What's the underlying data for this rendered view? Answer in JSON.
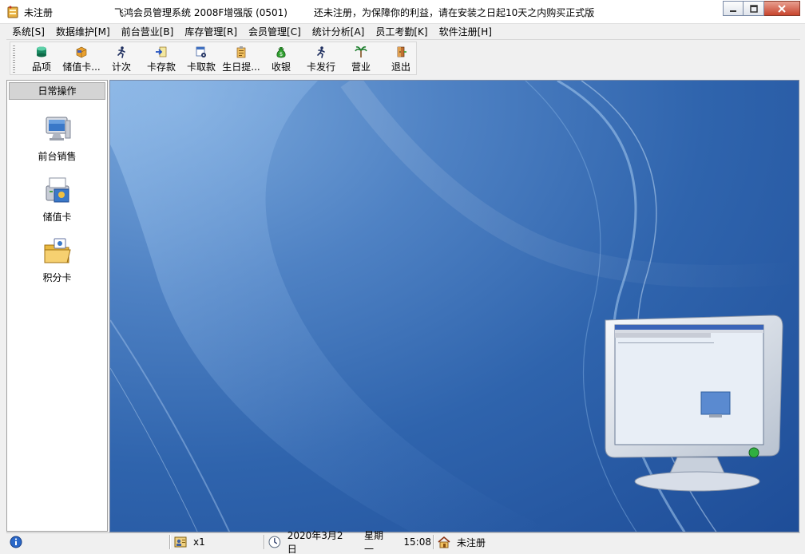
{
  "window": {
    "title_left": "未注册",
    "title_main": "飞鸿会员管理系统  2008F增强版 (0501)",
    "title_notice": "还未注册，为保障你的利益，请在安装之日起10天之内购买正式版"
  },
  "menu": [
    "系统[S]",
    "数据维护[M]",
    "前台营业[B]",
    "库存管理[R]",
    "会员管理[C]",
    "统计分析[A]",
    "员工考勤[K]",
    "软件注册[H]"
  ],
  "toolbar": [
    {
      "label": "品项",
      "icon": "database-icon"
    },
    {
      "label": "储值卡...",
      "icon": "card-box-icon"
    },
    {
      "label": "计次",
      "icon": "runner-icon"
    },
    {
      "label": "卡存款",
      "icon": "deposit-arrow-icon"
    },
    {
      "label": "卡取款",
      "icon": "withdraw-doc-icon"
    },
    {
      "label": "生日提...",
      "icon": "birthday-clipboard-icon"
    },
    {
      "label": "收银",
      "icon": "money-bag-icon"
    },
    {
      "label": "卡发行",
      "icon": "runner-icon"
    },
    {
      "label": "营业",
      "icon": "palm-tree-icon"
    },
    {
      "label": "退出",
      "icon": "exit-door-icon"
    }
  ],
  "sidebar": {
    "header": "日常操作",
    "items": [
      {
        "label": "前台销售",
        "icon": "computer-icon"
      },
      {
        "label": "储值卡",
        "icon": "printer-card-icon"
      },
      {
        "label": "积分卡",
        "icon": "folder-icon"
      }
    ]
  },
  "statusbar": {
    "count": "x1",
    "date": "2020年3月2日",
    "weekday": "星期一",
    "time": "15:08",
    "registration": "未注册"
  },
  "colors": {
    "wallpaper": "#2f64ad",
    "sidebar_header": "#d4d4d4",
    "window_bg": "#f0f0f0"
  }
}
